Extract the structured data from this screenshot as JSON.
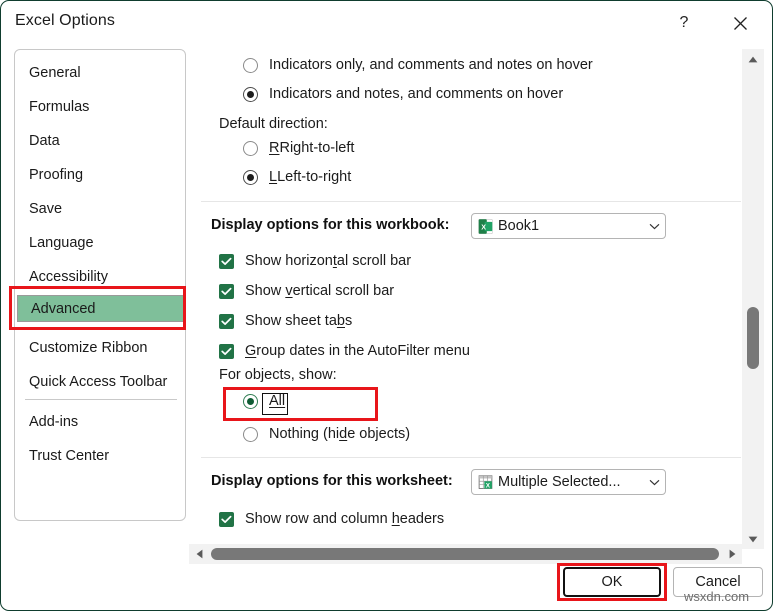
{
  "dialog": {
    "title": "Excel Options",
    "help_label": "?",
    "close_label": "×"
  },
  "sidebar": {
    "items": [
      {
        "label": "General",
        "selected": false
      },
      {
        "label": "Formulas",
        "selected": false
      },
      {
        "label": "Data",
        "selected": false
      },
      {
        "label": "Proofing",
        "selected": false
      },
      {
        "label": "Save",
        "selected": false
      },
      {
        "label": "Language",
        "selected": false
      },
      {
        "label": "Accessibility",
        "selected": false
      },
      {
        "label": "Advanced",
        "selected": true
      },
      {
        "label": "Customize Ribbon",
        "selected": false
      },
      {
        "label": "Quick Access Toolbar",
        "selected": false
      },
      {
        "label": "Add-ins",
        "selected": false
      },
      {
        "label": "Trust Center",
        "selected": false
      }
    ]
  },
  "content": {
    "comment_radios": [
      {
        "label": "Indicators only, and comments and notes on hover",
        "checked": false
      },
      {
        "label": "Indicators and notes, and comments on hover",
        "checked": true
      }
    ],
    "default_direction_label": "Default direction:",
    "direction_radios": [
      {
        "label": "Right-to-left",
        "checked": false
      },
      {
        "label": "Left-to-right",
        "checked": true
      }
    ],
    "workbook_section_title": "Display options for this workbook:",
    "workbook_dropdown_value": "Book1",
    "workbook_checkboxes": [
      {
        "label": "Show horizontal scroll bar",
        "checked": true
      },
      {
        "label": "Show vertical scroll bar",
        "checked": true
      },
      {
        "label": "Show sheet tabs",
        "checked": true
      },
      {
        "label": "Group dates in the AutoFilter menu",
        "checked": true
      }
    ],
    "for_objects_label": "For objects, show:",
    "object_radios": [
      {
        "label": "All",
        "checked": true
      },
      {
        "label": "Nothing (hide objects)",
        "checked": false
      }
    ],
    "worksheet_section_title": "Display options for this worksheet:",
    "worksheet_dropdown_value": "Multiple Selected...",
    "worksheet_checkboxes": [
      {
        "label": "Show row and column headers",
        "checked": true
      }
    ]
  },
  "footer": {
    "ok_label": "OK",
    "cancel_label": "Cancel"
  },
  "watermark": "wsxdn.com",
  "colors": {
    "excel_green": "#217346",
    "highlight_green": "#7fbf9a",
    "annotation_red": "#e8151a"
  }
}
